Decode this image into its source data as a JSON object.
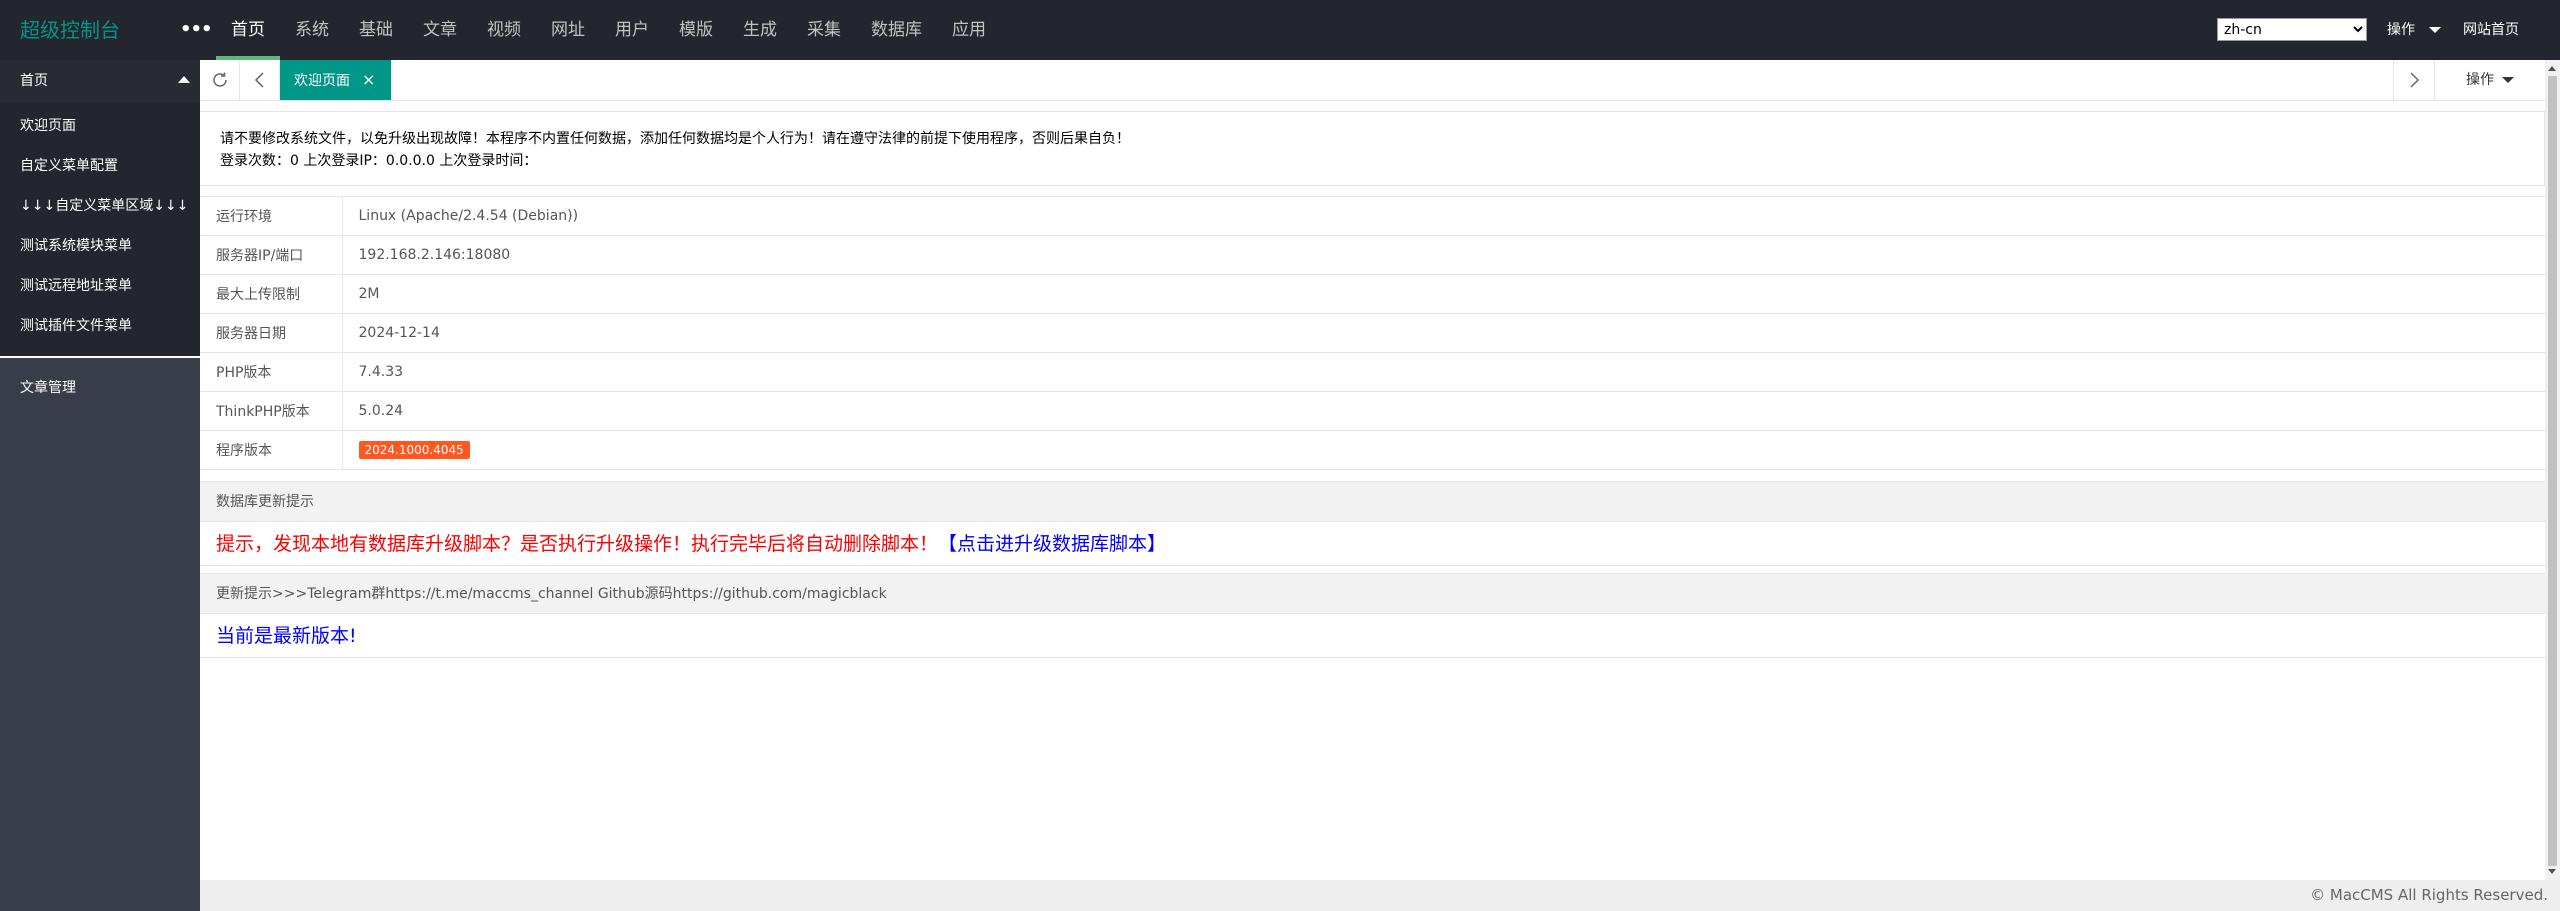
{
  "header": {
    "logo": "超级控制台",
    "more": "•••",
    "nav": [
      "首页",
      "系统",
      "基础",
      "文章",
      "视频",
      "网址",
      "用户",
      "模版",
      "生成",
      "采集",
      "数据库",
      "应用"
    ],
    "lang": "zh-cn",
    "operate": "操作",
    "site_home": "网站首页"
  },
  "sidebar": {
    "section": "首页",
    "items": [
      "欢迎页面",
      "自定义菜单配置",
      "↓↓↓自定义菜单区域↓↓↓",
      "测试系统模块菜单",
      "测试远程地址菜单",
      "测试插件文件菜单"
    ],
    "group2": "文章管理"
  },
  "tabs": {
    "active": "欢迎页面",
    "operate": "操作"
  },
  "notice": {
    "line1": "请不要修改系统文件，以免升级出现故障！本程序不内置任何数据，添加任何数据均是个人行为！请在遵守法律的前提下使用程序，否则后果自负！",
    "line2": "登录次数：0 上次登录IP：0.0.0.0 上次登录时间："
  },
  "info": [
    {
      "k": "运行环境",
      "v": "Linux (Apache/2.4.54 (Debian))"
    },
    {
      "k": "服务器IP/端口",
      "v": "192.168.2.146:18080"
    },
    {
      "k": "最大上传限制",
      "v": "2M"
    },
    {
      "k": "服务器日期",
      "v": "2024-12-14"
    },
    {
      "k": "PHP版本",
      "v": "7.4.33"
    },
    {
      "k": "ThinkPHP版本",
      "v": "5.0.24"
    },
    {
      "k": "程序版本",
      "v": "2024.1000.4045"
    }
  ],
  "db": {
    "title": "数据库更新提示",
    "text": "提示，发现本地有数据库升级脚本？是否执行升级操作！执行完毕后将自动删除脚本！",
    "link": "【点击进升级数据库脚本】"
  },
  "update": {
    "title": "更新提示>>>Telegram群https://t.me/maccms_channel    Github源码https://github.com/magicblack",
    "text": "当前是最新版本!"
  },
  "footer": "© MacCMS All Rights Reserved.",
  "colors": {
    "accent": "#009688",
    "header_bg": "#23262e",
    "sidebar_bg": "#393d49",
    "nav_indicator": "#5fb878",
    "badge": "#ff5722"
  }
}
